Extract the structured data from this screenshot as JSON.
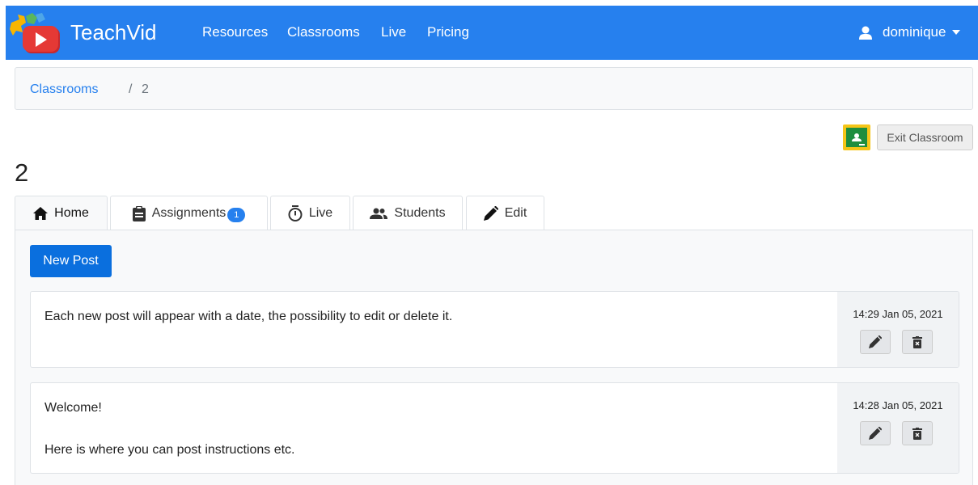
{
  "navbar": {
    "brand": "TeachVid",
    "links": [
      "Resources",
      "Classrooms",
      "Live",
      "Pricing"
    ],
    "user": "dominique",
    "color": "#2680ee"
  },
  "breadcrumb": {
    "parent": "Classrooms",
    "separator": "/",
    "current": "2"
  },
  "actions": {
    "google_classroom_icon": "google-classroom-icon",
    "exit_label": "Exit Classroom"
  },
  "page": {
    "title": "2"
  },
  "tabs": [
    {
      "label": "Home",
      "icon": "home-icon",
      "active": true
    },
    {
      "label": "Assignments",
      "icon": "clipboard-icon",
      "badge": "1"
    },
    {
      "label": "Live",
      "icon": "stopwatch-icon"
    },
    {
      "label": "Students",
      "icon": "users-icon"
    },
    {
      "label": "Edit",
      "icon": "pencil-icon"
    }
  ],
  "content": {
    "new_post_label": "New Post",
    "posts": [
      {
        "lines": [
          "Each new post will appear with a date, the possibility to edit or delete it."
        ],
        "date": "14:29 Jan 05, 2021"
      },
      {
        "lines": [
          "Welcome!",
          "Here is where you can post instructions etc."
        ],
        "date": "14:28 Jan 05, 2021"
      }
    ]
  }
}
